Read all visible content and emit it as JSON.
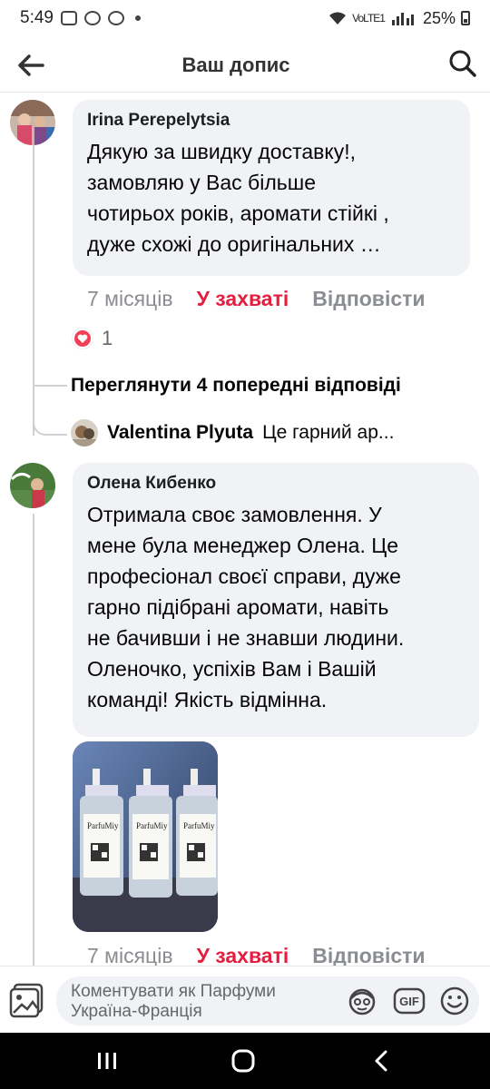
{
  "status_bar": {
    "time": "5:49",
    "network": "VoLTE1",
    "battery": "25%"
  },
  "header": {
    "title": "Ваш допис",
    "back_icon": "arrow-left-icon",
    "search_icon": "search-icon"
  },
  "comments": [
    {
      "author": "Irina Perepelytsia",
      "text": "Дякую за швидку доставку!,\nзамовляю у Вас більше\nчотирьох років, аромати  стійкі ,\nдуже схожі до оригінальних …",
      "time": "7 місяців",
      "like_label": "У захваті",
      "reply_label": "Відповісти",
      "reaction_count": "1"
    },
    {
      "author": "Олена Кибенко",
      "text": "Отримала своє замовлення. У\nмене була менеджер Олена. Це\nпрофесіонал своєї справи, дуже\nгарно підібрані аромати, навіть\nне бачивши і не знавши людини.\nОленочко, успіхів Вам і Вашій\nкоманді! Якість відмінна.",
      "time": "7 місяців",
      "like_label": "У захваті",
      "reply_label": "Відповісти",
      "photo_labels": [
        "ParfuMiy",
        "ParfuMiy",
        "ParfuMiy"
      ]
    }
  ],
  "thread": {
    "view_previous": "Переглянути 4 попередні відповіді",
    "reply_author": "Valentina Plyuta",
    "reply_snippet": "Це гарний ар..."
  },
  "composer": {
    "placeholder_line1": "Коментувати як Парфуми",
    "placeholder_line2": "Україна-Франція",
    "gif_label": "GIF"
  },
  "colors": {
    "like_red": "#e41e3f",
    "muted_gray": "#8a8d91",
    "bubble_bg": "#f0f2f5"
  }
}
